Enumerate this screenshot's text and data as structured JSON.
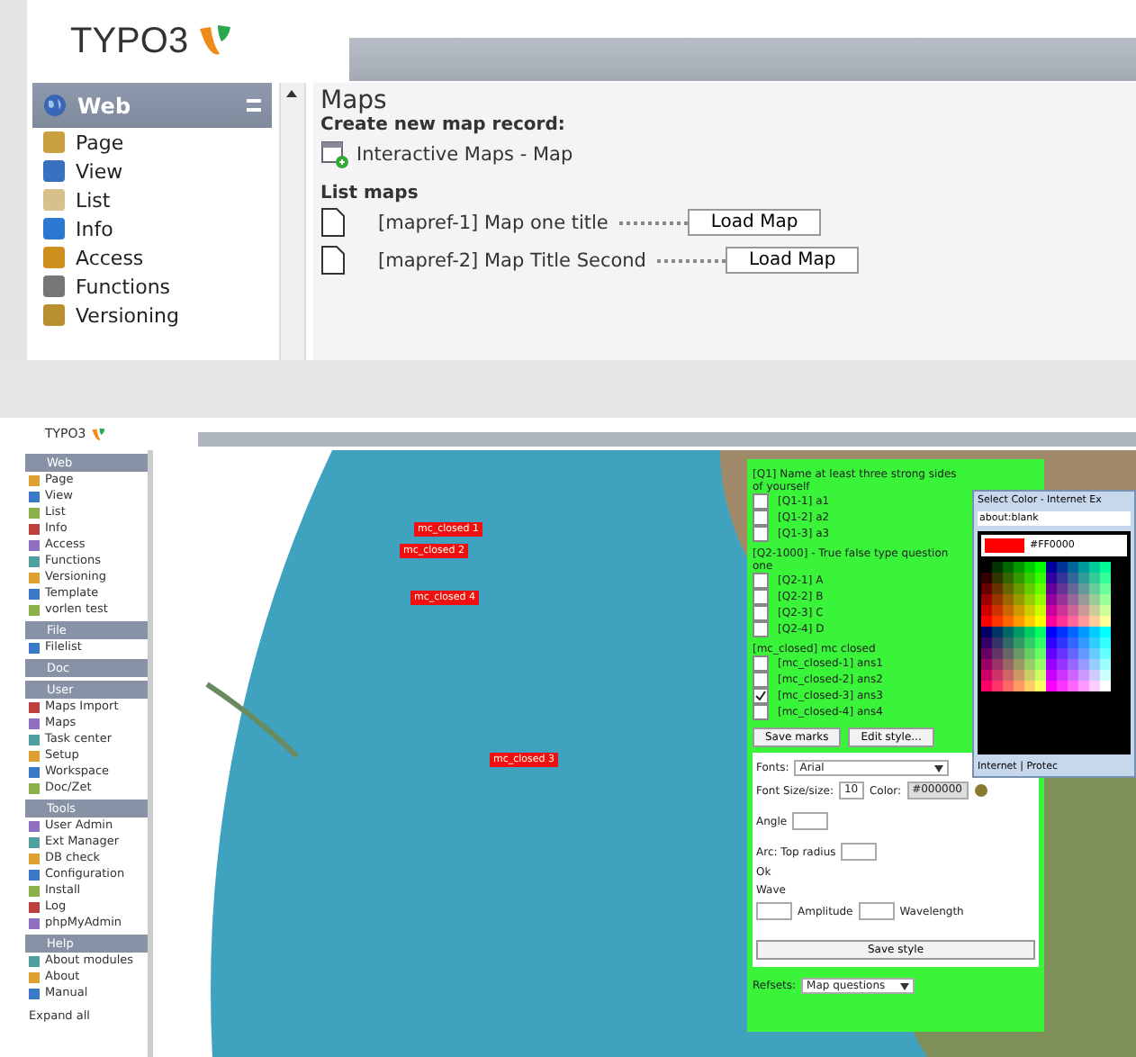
{
  "top": {
    "logo": "TYPO3",
    "module_menu": {
      "header": "Web",
      "items": [
        {
          "label": "Page",
          "kind": "page"
        },
        {
          "label": "View",
          "kind": "view"
        },
        {
          "label": "List",
          "kind": "list"
        },
        {
          "label": "Info",
          "kind": "info"
        },
        {
          "label": "Access",
          "kind": "access"
        },
        {
          "label": "Functions",
          "kind": "functions"
        },
        {
          "label": "Versioning",
          "kind": "versioning"
        }
      ]
    },
    "content": {
      "title": "Maps",
      "create_label": "Create new map record:",
      "create_link": "Interactive Maps - Map",
      "list_label": "List maps",
      "maps": [
        {
          "title": "[mapref-1] Map one title",
          "button": "Load Map"
        },
        {
          "title": "[mapref-2] Map Title Second",
          "button": "Load Map"
        }
      ]
    }
  },
  "bottom": {
    "logo": "TYPO3",
    "sidebar": [
      {
        "header": "Web",
        "items": [
          "Page",
          "View",
          "List",
          "Info",
          "Access",
          "Functions",
          "Versioning",
          "Template",
          "vorlen test"
        ]
      },
      {
        "header": "File",
        "items": [
          "Filelist"
        ]
      },
      {
        "header": "Doc"
      },
      {
        "header": "User",
        "items": [
          "Maps Import",
          "Maps",
          "Task center",
          "Setup",
          "Workspace",
          "Doc/Zet"
        ]
      },
      {
        "header": "Tools",
        "items": [
          "User Admin",
          "Ext Manager",
          "DB check",
          "Configuration",
          "Install",
          "Log",
          "phpMyAdmin"
        ]
      },
      {
        "header": "Help",
        "items": [
          "About modules",
          "About",
          "Manual"
        ]
      }
    ],
    "expand_all": "Expand all",
    "map": {
      "markers": [
        "mc_closed 1",
        "mc_closed 2",
        "mc_closed 4",
        "mc_closed 3"
      ]
    },
    "question_panel": {
      "questions": [
        {
          "title": "[Q1] Name at least three strong sides of yourself",
          "answers": [
            {
              "label": "[Q1-1] a1",
              "checked": false
            },
            {
              "label": "[Q1-2] a2",
              "checked": false
            },
            {
              "label": "[Q1-3] a3",
              "checked": false
            }
          ]
        },
        {
          "title": "[Q2-1000] - True false type question one",
          "answers": [
            {
              "label": "[Q2-1] A",
              "checked": false
            },
            {
              "label": "[Q2-2] B",
              "checked": false
            },
            {
              "label": "[Q2-3] C",
              "checked": false
            },
            {
              "label": "[Q2-4] D",
              "checked": false
            }
          ]
        },
        {
          "title": "[mc_closed] mc closed",
          "answers": [
            {
              "label": "[mc_closed-1] ans1",
              "checked": false
            },
            {
              "label": "[mc_closed-2] ans2",
              "checked": false
            },
            {
              "label": "[mc_closed-3] ans3",
              "checked": true
            },
            {
              "label": "[mc_closed-4] ans4",
              "checked": false
            }
          ]
        }
      ],
      "buttons": [
        "Save marks",
        "Edit style..."
      ],
      "style_form": {
        "font_label": "Fonts:",
        "font_value": "Arial",
        "size_label": "Font Size/size:",
        "size_value": "10",
        "color_label": "Color:",
        "color_value": "#000000",
        "angle_label": "Angle",
        "arc_label": "Arc: Top radius",
        "ok_label": "Ok",
        "wave_label": "Wave",
        "amplitude_label": "Amplitude",
        "wavelength_label": "Wavelength",
        "save": "Save style"
      },
      "refsets_label": "Refsets:",
      "refsets_value": "Map questions"
    },
    "color_picker": {
      "title": "Select Color - Internet Ex",
      "address": "about:blank",
      "hex": "#FF0000",
      "status": "Internet | Protec"
    }
  }
}
